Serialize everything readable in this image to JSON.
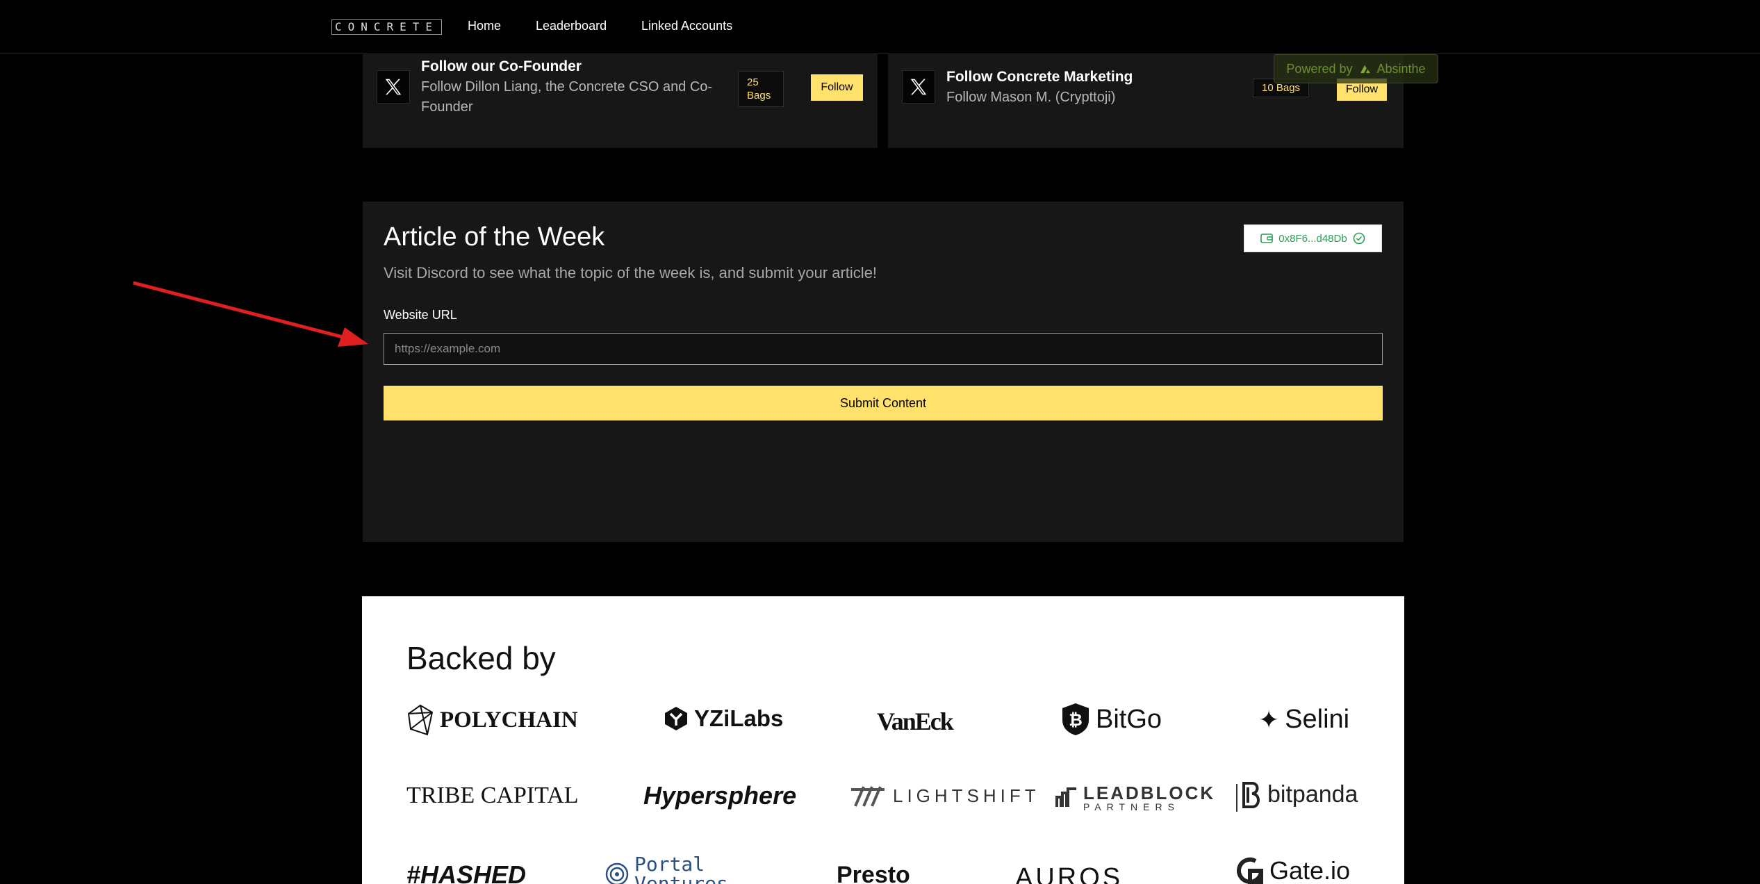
{
  "nav": {
    "logo": "CONCRETE",
    "links": [
      "Home",
      "Leaderboard",
      "Linked Accounts"
    ]
  },
  "powered_badge": {
    "prefix": "Powered by",
    "brand": "Absinthe"
  },
  "quests": [
    {
      "title": "Follow our Co-Founder",
      "description": "Follow Dillon Liang, the Concrete CSO and Co-Founder",
      "bags_count": "25",
      "bags_unit": "Bags",
      "action": "Follow"
    },
    {
      "title": "Follow Concrete Marketing",
      "description": "Follow Mason M. (Crypttoji)",
      "bags_label": "10 Bags",
      "action": "Follow"
    }
  ],
  "article": {
    "title": "Article of the Week",
    "subtitle": "Visit Discord to see what the topic of the week is, and submit your article!",
    "wallet_address": "0x8F6...d48Db",
    "field_label": "Website URL",
    "field_placeholder": "https://example.com",
    "field_value": "",
    "submit_label": "Submit Content"
  },
  "backed_by": {
    "title": "Backed by",
    "logos": [
      "POLYCHAIN",
      "YZiLabs",
      "VanEck",
      "BitGo",
      "Selini",
      "TRIBE CAPITAL",
      "Hypersphere",
      "LIGHTSHIFT",
      "LEADBLOCK",
      "PARTNERS",
      "bitpanda",
      "#HASHED",
      "Portal",
      "Ventures",
      "Presto",
      "AUROS",
      "Gate.io"
    ]
  },
  "colors": {
    "accent_yellow": "#ffe16b",
    "card_bg": "#171717",
    "wallet_green": "#2a9d55",
    "annotation_red": "#e02020"
  }
}
